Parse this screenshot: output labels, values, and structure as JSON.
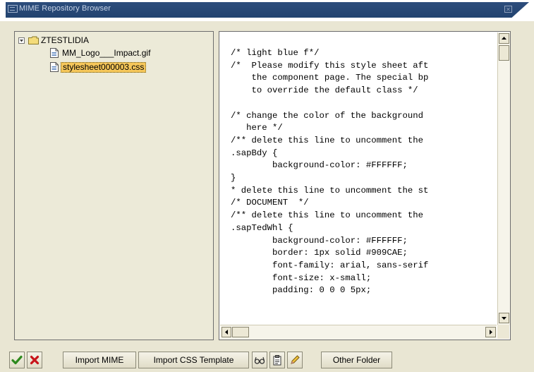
{
  "window": {
    "title": "MIME Repository Browser",
    "icons": {
      "title": "window-icon",
      "close": "close-icon"
    }
  },
  "tree": {
    "root": {
      "label": "ZTESTLIDIA",
      "icon": "folder-icon",
      "expanded": true
    },
    "files": [
      {
        "label": "MM_Logo___Impact.gif",
        "icon": "file-icon",
        "selected": false
      },
      {
        "label": "stylesheet000003.css",
        "icon": "file-icon",
        "selected": true
      }
    ]
  },
  "editor": {
    "lines": [
      "/* light blue f*/",
      "/*  Please modify this style sheet aft",
      "    the component page. The special bp",
      "    to override the default class */",
      "",
      "/* change the color of the background",
      "   here */",
      "/** delete this line to uncomment the",
      ".sapBdy {",
      "        background-color: #FFFFFF;",
      "}",
      "* delete this line to uncomment the st",
      "/* DOCUMENT  */",
      "/** delete this line to uncomment the",
      ".sapTedWhl {",
      "        background-color: #FFFFFF;",
      "        border: 1px solid #909CAE;",
      "        font-family: arial, sans-serif",
      "        font-size: x-small;",
      "        padding: 0 0 0 5px;"
    ]
  },
  "toolbar": {
    "import_mime": "Import MIME",
    "import_css": "Import CSS Template",
    "other_folder": "Other Folder",
    "icons": [
      "checkmark-icon",
      "cancel-icon",
      "glasses-icon",
      "clipboard-icon",
      "pencil-icon"
    ]
  },
  "colors": {
    "titlebar": "#2d4d7c",
    "background": "#e9e6d3",
    "selection": "#f6c75a",
    "check": "#2e8a1e",
    "cancel": "#c8141a"
  }
}
